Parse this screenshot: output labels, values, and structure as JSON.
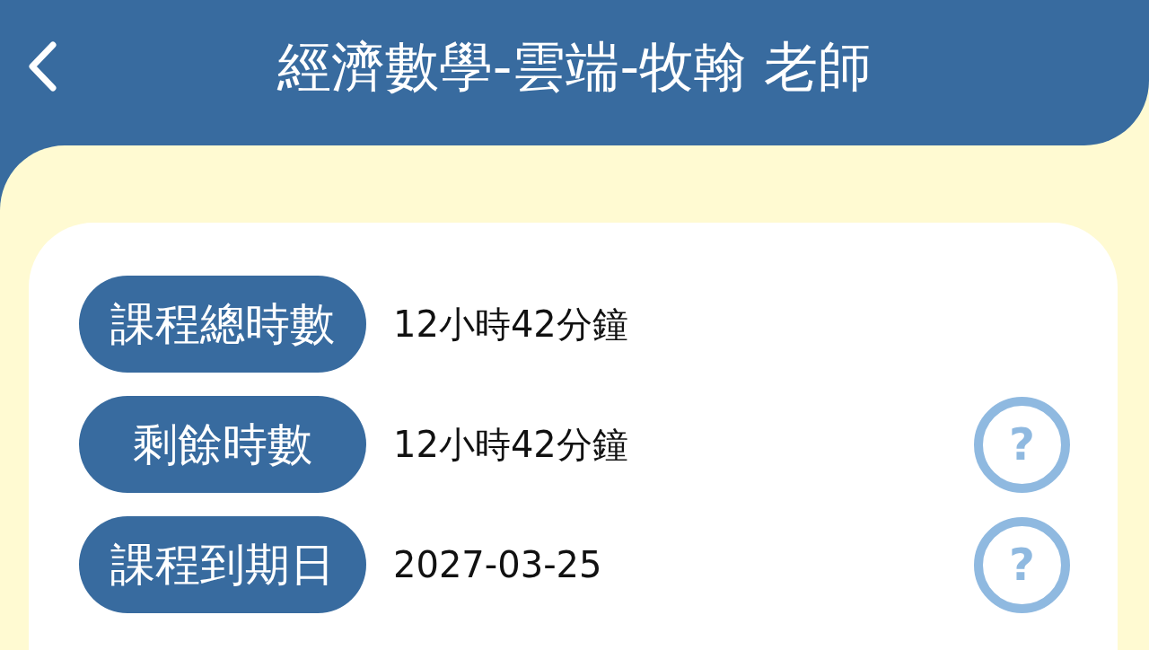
{
  "header": {
    "title": "經濟數學-雲端-牧翰 老師"
  },
  "rows": [
    {
      "label": "課程總時數",
      "value": "12小時42分鐘"
    },
    {
      "label": "剩餘時數",
      "value": "12小時42分鐘",
      "help": "?"
    },
    {
      "label": "課程到期日",
      "value": "2027-03-25",
      "help": "?"
    }
  ]
}
